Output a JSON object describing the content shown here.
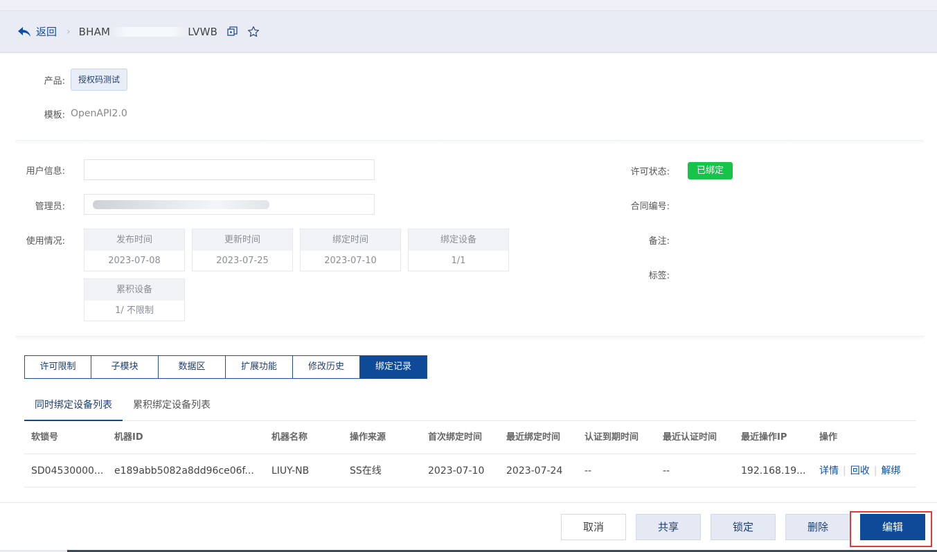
{
  "header": {
    "back_label": "返回",
    "title_left": "BHAM",
    "title_right": "LVWB"
  },
  "info": {
    "product_label": "产品:",
    "product_value": "授权码测试",
    "template_label": "模板:",
    "template_value": "OpenAPI2.0"
  },
  "details": {
    "user_info_label": "用户信息:",
    "user_info_value": "",
    "admin_label": "管理员:",
    "usage_label": "使用情况:",
    "license_status_label": "许可状态:",
    "license_status_value": "已绑定",
    "contract_label": "合同编号:",
    "remark_label": "备注:",
    "tag_label": "标签:"
  },
  "usage": [
    {
      "label": "发布时间",
      "value": "2023-07-08"
    },
    {
      "label": "更新时间",
      "value": "2023-07-25"
    },
    {
      "label": "绑定时间",
      "value": "2023-07-10"
    },
    {
      "label": "绑定设备",
      "value": "1/1"
    },
    {
      "label": "累积设备",
      "value": "1/ 不限制"
    }
  ],
  "tabs": [
    "许可限制",
    "子模块",
    "数据区",
    "扩展功能",
    "修改历史",
    "绑定记录"
  ],
  "active_tab": "绑定记录",
  "subtabs": [
    "同时绑定设备列表",
    "累积绑定设备列表"
  ],
  "table": {
    "columns": [
      "软锁号",
      "机器ID",
      "机器名称",
      "操作来源",
      "首次绑定时间",
      "最近绑定时间",
      "认证到期时间",
      "最近认证时间",
      "最近操作IP",
      "操作"
    ],
    "rows": [
      {
        "lock_id": "SD04530000...",
        "machine_id": "e189abb5082a8dd96ce06f...",
        "machine_name": "LIUY-NB",
        "source": "SS在线",
        "first_bind": "2023-07-10",
        "last_bind": "2023-07-24",
        "auth_expire": "--",
        "last_auth": "--",
        "last_ip": "192.168.19...",
        "actions": [
          "详情",
          "回收",
          "解绑"
        ]
      }
    ]
  },
  "footer": {
    "cancel": "取消",
    "share": "共享",
    "lock": "锁定",
    "delete": "删除",
    "edit": "编辑"
  },
  "colors": {
    "primary": "#0f4a98",
    "status_green": "#16c44a",
    "highlight_red": "#e03a3a"
  }
}
